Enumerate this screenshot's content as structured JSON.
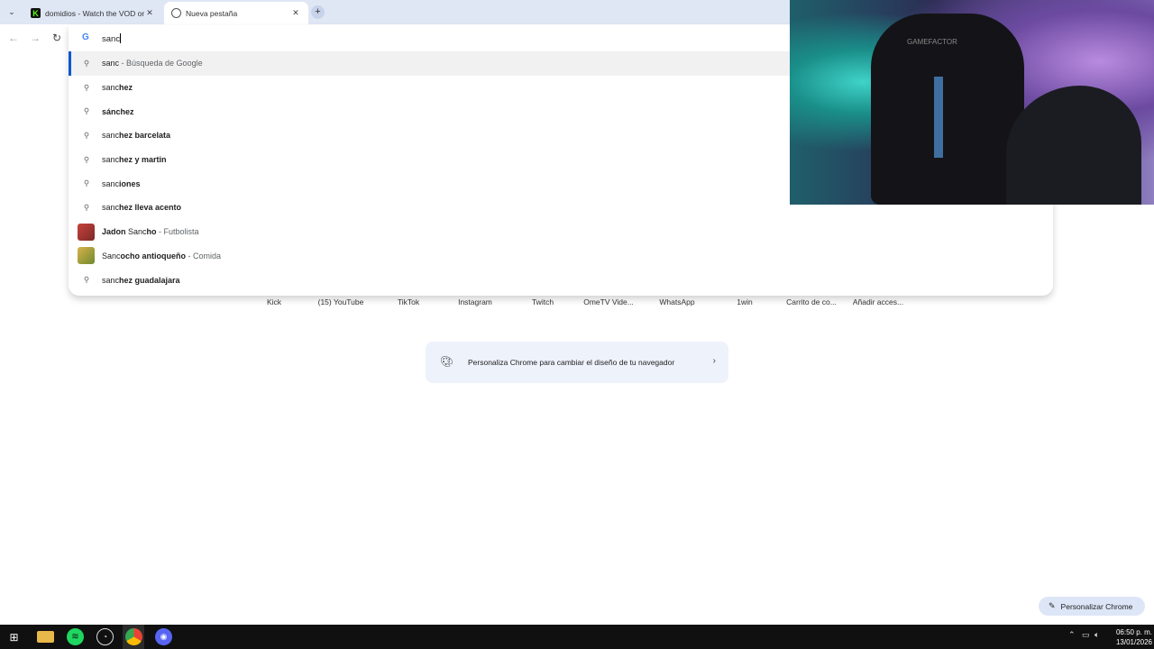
{
  "browser": {
    "tabs": [
      {
        "title": "domidios - Watch the VOD on K",
        "favicon": "kick-icon",
        "active": false
      },
      {
        "title": "Nueva pestaña",
        "favicon": "chrome-newtab-icon",
        "active": true
      }
    ],
    "omnibox": {
      "value": "sanc",
      "search_engine_icon": "google-g-icon"
    },
    "suggestions": [
      {
        "icon": "search-icon",
        "parts": [
          {
            "t": "sanc",
            "b": false
          }
        ],
        "suffix": " - Búsqueda de Google",
        "selected": true
      },
      {
        "icon": "search-icon",
        "parts": [
          {
            "t": "sanc",
            "b": false
          },
          {
            "t": "hez",
            "b": true
          }
        ],
        "suffix": ""
      },
      {
        "icon": "search-icon",
        "parts": [
          {
            "t": "sánchez",
            "b": true
          }
        ],
        "suffix": ""
      },
      {
        "icon": "search-icon",
        "parts": [
          {
            "t": "sanc",
            "b": false
          },
          {
            "t": "hez barcelata",
            "b": true
          }
        ],
        "suffix": ""
      },
      {
        "icon": "search-icon",
        "parts": [
          {
            "t": "sanc",
            "b": false
          },
          {
            "t": "hez y martin",
            "b": true
          }
        ],
        "suffix": ""
      },
      {
        "icon": "search-icon",
        "parts": [
          {
            "t": "sanc",
            "b": false
          },
          {
            "t": "iones",
            "b": true
          }
        ],
        "suffix": ""
      },
      {
        "icon": "search-icon",
        "parts": [
          {
            "t": "sanc",
            "b": false
          },
          {
            "t": "hez lleva acento",
            "b": true
          }
        ],
        "suffix": ""
      },
      {
        "icon": "person-thumbnail",
        "parts": [
          {
            "t": "Jadon ",
            "b": true
          },
          {
            "t": "Sanc",
            "b": false
          },
          {
            "t": "ho",
            "b": true
          }
        ],
        "suffix": " - Futbolista"
      },
      {
        "icon": "food-thumbnail",
        "parts": [
          {
            "t": "Sanc",
            "b": false
          },
          {
            "t": "ocho antioqueño",
            "b": true
          }
        ],
        "suffix": " - Comida"
      },
      {
        "icon": "search-icon",
        "parts": [
          {
            "t": "sanc",
            "b": false
          },
          {
            "t": "hez guadalajara",
            "b": true
          }
        ],
        "suffix": ""
      }
    ]
  },
  "newtab": {
    "shortcuts": [
      "Kick",
      "(15) YouTube",
      "TikTok",
      "Instagram",
      "Twitch",
      "OmeTV Vide...",
      "WhatsApp",
      "1win",
      "Carrito de co...",
      "Añadir acces..."
    ],
    "customize_card_text": "Personaliza Chrome para cambiar el diseño de tu navegador",
    "customize_button": "Personalizar Chrome"
  },
  "webcam": {
    "chair_brand": "GAMEFACTOR"
  },
  "taskbar": {
    "time": "06:50 p. m.",
    "date": "13/01/2026"
  },
  "colors": {
    "tabstrip": "#dfe7f5",
    "selection_accent": "#0b57d0",
    "taskbar": "#101010"
  }
}
